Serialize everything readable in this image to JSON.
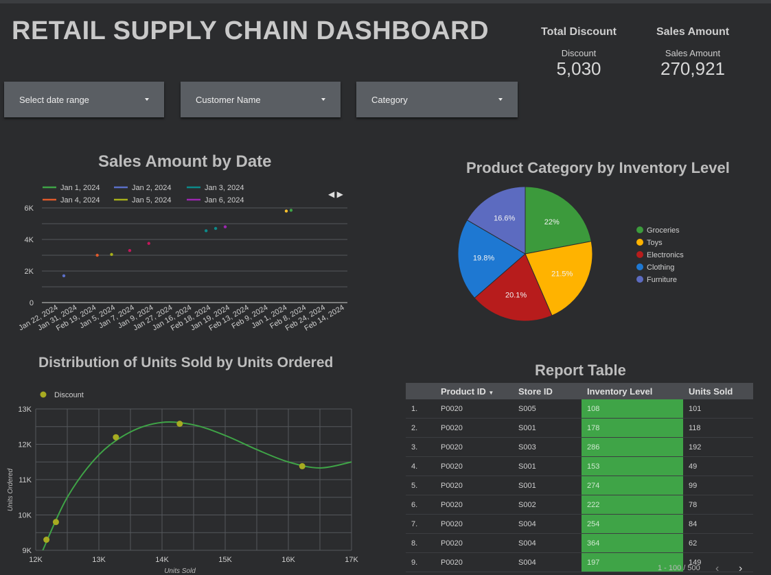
{
  "title": "RETAIL SUPPLY CHAIN DASHBOARD",
  "kpis": [
    {
      "heading": "Total Discount",
      "label": "Discount",
      "value": "5,030"
    },
    {
      "heading": "Sales Amount",
      "label": "Sales Amount",
      "value": "270,921"
    }
  ],
  "filters": [
    "Select date range",
    "Customer Name",
    "Category"
  ],
  "sales_chart": {
    "title": "Sales Amount by Date",
    "legend": [
      {
        "name": "Jan 1, 2024",
        "color": "#3fa447"
      },
      {
        "name": "Jan 2, 2024",
        "color": "#5b6fc7"
      },
      {
        "name": "Jan 3, 2024",
        "color": "#0c8a8a"
      },
      {
        "name": "Jan 4, 2024",
        "color": "#e05a2b"
      },
      {
        "name": "Jan 5, 2024",
        "color": "#a7b01a"
      },
      {
        "name": "Jan 6, 2024",
        "color": "#9c27b0"
      }
    ],
    "nav_arrows": "◀ ▶"
  },
  "pie_chart": {
    "title": "Product Category by Inventory Level"
  },
  "scatter_chart": {
    "title": "Distribution of Units Sold by Units Ordered",
    "legend": "Discount"
  },
  "chart_data": [
    {
      "type": "scatter",
      "title": "Sales Amount by Date",
      "categories": [
        "Jan 22, 2024",
        "Jan 31, 2024",
        "Feb 19, 2024",
        "Jan 5, 2024",
        "Jan 7, 2024",
        "Jan 9, 2024",
        "Jan 27, 2024",
        "Jan 16, 2024",
        "Feb 18, 2024",
        "Jan 19, 2024",
        "Feb 13, 2024",
        "Feb 9, 2024",
        "Jan 1, 2024",
        "Feb 8, 2024",
        "Feb 24, 2024",
        "Feb 14, 2024"
      ],
      "yticks": [
        "0",
        "2K",
        "4K",
        "6K"
      ],
      "ylim": [
        0,
        6000
      ],
      "points": [
        {
          "cat": 0.65,
          "y": 1700,
          "color": "#5b6fc7"
        },
        {
          "cat": 2.4,
          "y": 3000,
          "color": "#e05a2b"
        },
        {
          "cat": 3.15,
          "y": 3050,
          "color": "#a7b01a"
        },
        {
          "cat": 4.1,
          "y": 3300,
          "color": "#c2185b"
        },
        {
          "cat": 5.1,
          "y": 3750,
          "color": "#c2185b"
        },
        {
          "cat": 8.1,
          "y": 4550,
          "color": "#0c8a8a"
        },
        {
          "cat": 8.6,
          "y": 4700,
          "color": "#0c8a8a"
        },
        {
          "cat": 9.1,
          "y": 4800,
          "color": "#9c27b0"
        },
        {
          "cat": 12.3,
          "y": 5800,
          "color": "#fbc02d"
        },
        {
          "cat": 12.55,
          "y": 5850,
          "color": "#3fa447"
        }
      ]
    },
    {
      "type": "pie",
      "title": "Product Category by Inventory Level",
      "slices": [
        {
          "name": "Groceries",
          "value": 22.0,
          "label": "22%",
          "color": "#3c9a3c"
        },
        {
          "name": "Toys",
          "value": 21.5,
          "label": "21.5%",
          "color": "#ffb300"
        },
        {
          "name": "Electronics",
          "value": 20.1,
          "label": "20.1%",
          "color": "#b71c1c"
        },
        {
          "name": "Clothing",
          "value": 19.8,
          "label": "19.8%",
          "color": "#1e78d2"
        },
        {
          "name": "Furniture",
          "value": 16.6,
          "label": "16.6%",
          "color": "#5c6bc0"
        }
      ]
    },
    {
      "type": "scatter",
      "title": "Distribution of Units Sold by Units Ordered",
      "xlabel": "Units Sold",
      "ylabel": "Units Ordered",
      "xlim": [
        12000,
        17000
      ],
      "ylim": [
        9000,
        13000
      ],
      "xticks": [
        "12K",
        "13K",
        "14K",
        "15K",
        "16K",
        "17K"
      ],
      "yticks": [
        "9K",
        "10K",
        "11K",
        "12K",
        "13K"
      ],
      "series": [
        {
          "name": "Discount",
          "color": "#a7ab21",
          "points": [
            [
              12170,
              9300
            ],
            [
              12320,
              9800
            ],
            [
              13270,
              12200
            ],
            [
              14280,
              12580
            ],
            [
              16220,
              11380
            ]
          ]
        }
      ],
      "trend": [
        [
          12100,
          8950
        ],
        [
          12500,
          10500
        ],
        [
          13000,
          11700
        ],
        [
          13500,
          12350
        ],
        [
          14000,
          12620
        ],
        [
          14500,
          12550
        ],
        [
          15000,
          12250
        ],
        [
          15500,
          11850
        ],
        [
          16000,
          11500
        ],
        [
          16500,
          11330
        ],
        [
          17000,
          11500
        ]
      ]
    }
  ],
  "table": {
    "title": "Report Table",
    "columns": [
      "Product ID",
      "Store ID",
      "Inventory Level",
      "Units Sold"
    ],
    "rows": [
      [
        "1.",
        "P0020",
        "S005",
        "108",
        "101"
      ],
      [
        "2.",
        "P0020",
        "S001",
        "178",
        "118"
      ],
      [
        "3.",
        "P0020",
        "S003",
        "286",
        "192"
      ],
      [
        "4.",
        "P0020",
        "S001",
        "153",
        "49"
      ],
      [
        "5.",
        "P0020",
        "S001",
        "274",
        "99"
      ],
      [
        "6.",
        "P0020",
        "S002",
        "222",
        "78"
      ],
      [
        "7.",
        "P0020",
        "S004",
        "254",
        "84"
      ],
      [
        "8.",
        "P0020",
        "S004",
        "364",
        "62"
      ],
      [
        "9.",
        "P0020",
        "S004",
        "197",
        "149"
      ]
    ],
    "pagination": "1 - 100 / 500"
  }
}
